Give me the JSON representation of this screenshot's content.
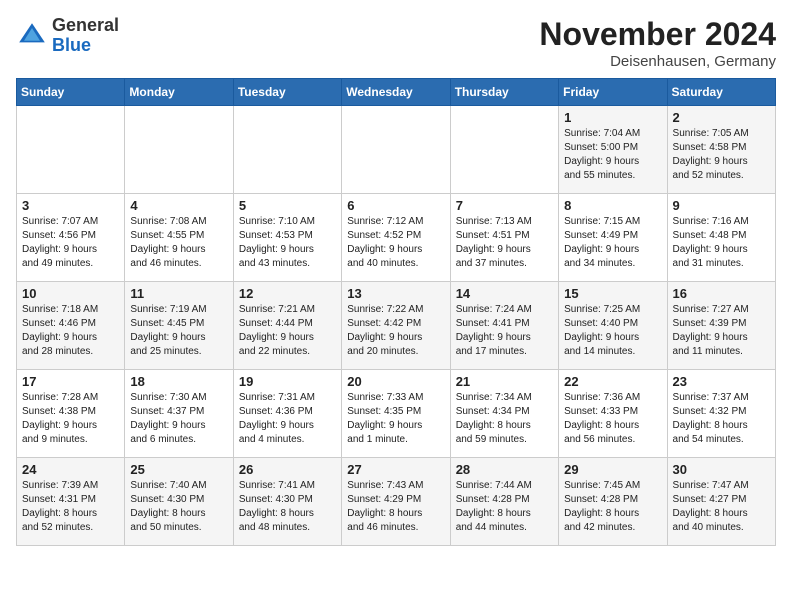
{
  "header": {
    "logo": {
      "general": "General",
      "blue": "Blue"
    },
    "title": "November 2024",
    "location": "Deisenhausen, Germany"
  },
  "weekdays": [
    "Sunday",
    "Monday",
    "Tuesday",
    "Wednesday",
    "Thursday",
    "Friday",
    "Saturday"
  ],
  "weeks": [
    [
      {
        "day": "",
        "info": ""
      },
      {
        "day": "",
        "info": ""
      },
      {
        "day": "",
        "info": ""
      },
      {
        "day": "",
        "info": ""
      },
      {
        "day": "",
        "info": ""
      },
      {
        "day": "1",
        "info": "Sunrise: 7:04 AM\nSunset: 5:00 PM\nDaylight: 9 hours\nand 55 minutes."
      },
      {
        "day": "2",
        "info": "Sunrise: 7:05 AM\nSunset: 4:58 PM\nDaylight: 9 hours\nand 52 minutes."
      }
    ],
    [
      {
        "day": "3",
        "info": "Sunrise: 7:07 AM\nSunset: 4:56 PM\nDaylight: 9 hours\nand 49 minutes."
      },
      {
        "day": "4",
        "info": "Sunrise: 7:08 AM\nSunset: 4:55 PM\nDaylight: 9 hours\nand 46 minutes."
      },
      {
        "day": "5",
        "info": "Sunrise: 7:10 AM\nSunset: 4:53 PM\nDaylight: 9 hours\nand 43 minutes."
      },
      {
        "day": "6",
        "info": "Sunrise: 7:12 AM\nSunset: 4:52 PM\nDaylight: 9 hours\nand 40 minutes."
      },
      {
        "day": "7",
        "info": "Sunrise: 7:13 AM\nSunset: 4:51 PM\nDaylight: 9 hours\nand 37 minutes."
      },
      {
        "day": "8",
        "info": "Sunrise: 7:15 AM\nSunset: 4:49 PM\nDaylight: 9 hours\nand 34 minutes."
      },
      {
        "day": "9",
        "info": "Sunrise: 7:16 AM\nSunset: 4:48 PM\nDaylight: 9 hours\nand 31 minutes."
      }
    ],
    [
      {
        "day": "10",
        "info": "Sunrise: 7:18 AM\nSunset: 4:46 PM\nDaylight: 9 hours\nand 28 minutes."
      },
      {
        "day": "11",
        "info": "Sunrise: 7:19 AM\nSunset: 4:45 PM\nDaylight: 9 hours\nand 25 minutes."
      },
      {
        "day": "12",
        "info": "Sunrise: 7:21 AM\nSunset: 4:44 PM\nDaylight: 9 hours\nand 22 minutes."
      },
      {
        "day": "13",
        "info": "Sunrise: 7:22 AM\nSunset: 4:42 PM\nDaylight: 9 hours\nand 20 minutes."
      },
      {
        "day": "14",
        "info": "Sunrise: 7:24 AM\nSunset: 4:41 PM\nDaylight: 9 hours\nand 17 minutes."
      },
      {
        "day": "15",
        "info": "Sunrise: 7:25 AM\nSunset: 4:40 PM\nDaylight: 9 hours\nand 14 minutes."
      },
      {
        "day": "16",
        "info": "Sunrise: 7:27 AM\nSunset: 4:39 PM\nDaylight: 9 hours\nand 11 minutes."
      }
    ],
    [
      {
        "day": "17",
        "info": "Sunrise: 7:28 AM\nSunset: 4:38 PM\nDaylight: 9 hours\nand 9 minutes."
      },
      {
        "day": "18",
        "info": "Sunrise: 7:30 AM\nSunset: 4:37 PM\nDaylight: 9 hours\nand 6 minutes."
      },
      {
        "day": "19",
        "info": "Sunrise: 7:31 AM\nSunset: 4:36 PM\nDaylight: 9 hours\nand 4 minutes."
      },
      {
        "day": "20",
        "info": "Sunrise: 7:33 AM\nSunset: 4:35 PM\nDaylight: 9 hours\nand 1 minute."
      },
      {
        "day": "21",
        "info": "Sunrise: 7:34 AM\nSunset: 4:34 PM\nDaylight: 8 hours\nand 59 minutes."
      },
      {
        "day": "22",
        "info": "Sunrise: 7:36 AM\nSunset: 4:33 PM\nDaylight: 8 hours\nand 56 minutes."
      },
      {
        "day": "23",
        "info": "Sunrise: 7:37 AM\nSunset: 4:32 PM\nDaylight: 8 hours\nand 54 minutes."
      }
    ],
    [
      {
        "day": "24",
        "info": "Sunrise: 7:39 AM\nSunset: 4:31 PM\nDaylight: 8 hours\nand 52 minutes."
      },
      {
        "day": "25",
        "info": "Sunrise: 7:40 AM\nSunset: 4:30 PM\nDaylight: 8 hours\nand 50 minutes."
      },
      {
        "day": "26",
        "info": "Sunrise: 7:41 AM\nSunset: 4:30 PM\nDaylight: 8 hours\nand 48 minutes."
      },
      {
        "day": "27",
        "info": "Sunrise: 7:43 AM\nSunset: 4:29 PM\nDaylight: 8 hours\nand 46 minutes."
      },
      {
        "day": "28",
        "info": "Sunrise: 7:44 AM\nSunset: 4:28 PM\nDaylight: 8 hours\nand 44 minutes."
      },
      {
        "day": "29",
        "info": "Sunrise: 7:45 AM\nSunset: 4:28 PM\nDaylight: 8 hours\nand 42 minutes."
      },
      {
        "day": "30",
        "info": "Sunrise: 7:47 AM\nSunset: 4:27 PM\nDaylight: 8 hours\nand 40 minutes."
      }
    ]
  ]
}
